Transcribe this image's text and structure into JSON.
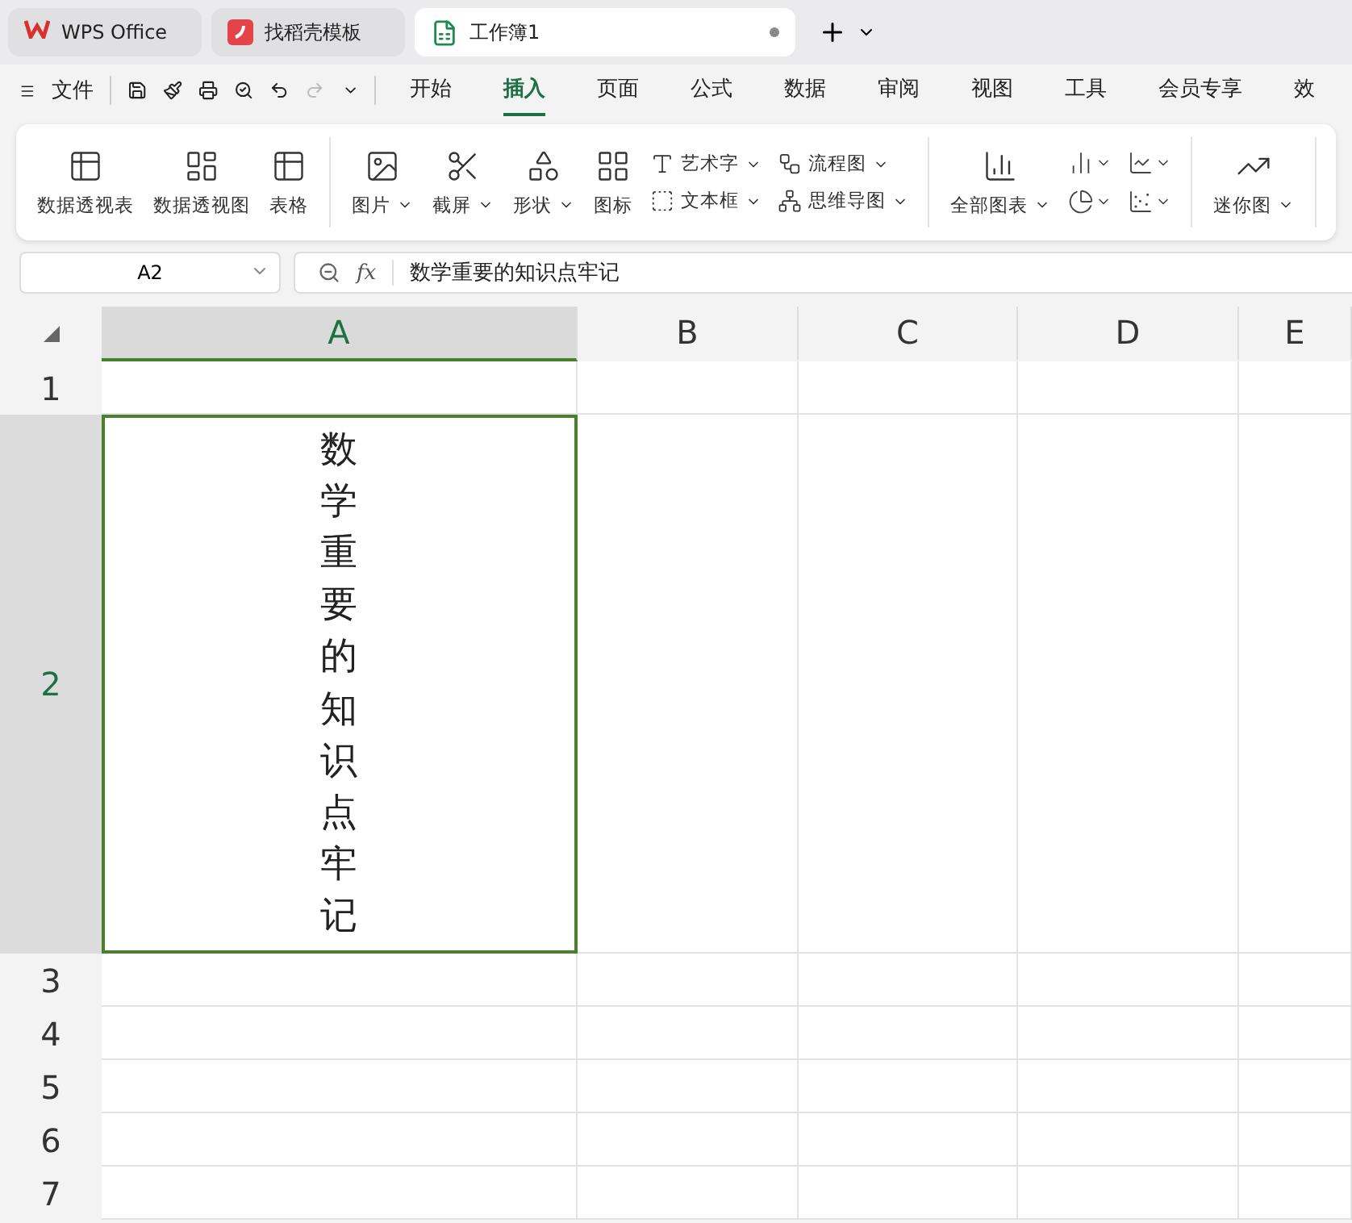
{
  "title_tabs": [
    {
      "label": "WPS Office",
      "kind": "wps",
      "selected": false
    },
    {
      "label": "找稻壳模板",
      "kind": "template",
      "selected": false
    },
    {
      "label": "工作簿1",
      "kind": "sheet",
      "selected": true
    }
  ],
  "menu": {
    "file": "文件",
    "tabs": [
      {
        "label": "开始",
        "selected": false
      },
      {
        "label": "插入",
        "selected": true
      },
      {
        "label": "页面",
        "selected": false
      },
      {
        "label": "公式",
        "selected": false
      },
      {
        "label": "数据",
        "selected": false
      },
      {
        "label": "审阅",
        "selected": false
      },
      {
        "label": "视图",
        "selected": false
      },
      {
        "label": "工具",
        "selected": false
      },
      {
        "label": "会员专享",
        "selected": false
      },
      {
        "label": "效",
        "selected": false
      }
    ]
  },
  "ribbon": [
    {
      "items": [
        {
          "kind": "large",
          "label": "数据透视表",
          "dropdown": false
        },
        {
          "kind": "large",
          "label": "数据透视图",
          "dropdown": false
        },
        {
          "kind": "large",
          "label": "表格",
          "dropdown": false
        }
      ]
    },
    {
      "items": [
        {
          "kind": "large",
          "label": "图片",
          "dropdown": true
        },
        {
          "kind": "large",
          "label": "截屏",
          "dropdown": true
        },
        {
          "kind": "large",
          "label": "形状",
          "dropdown": true
        },
        {
          "kind": "large",
          "label": "图标",
          "dropdown": false
        },
        {
          "kind": "stack",
          "items": [
            {
              "label": "艺术字",
              "dropdown": true
            },
            {
              "label": "文本框",
              "dropdown": true
            }
          ]
        },
        {
          "kind": "stack",
          "items": [
            {
              "label": "流程图",
              "dropdown": true
            },
            {
              "label": "思维导图",
              "dropdown": true
            }
          ]
        }
      ]
    },
    {
      "items": [
        {
          "kind": "large",
          "label": "全部图表",
          "dropdown": true
        },
        {
          "kind": "chart_types"
        }
      ]
    },
    {
      "items": [
        {
          "kind": "large",
          "label": "迷你图",
          "dropdown": true
        }
      ]
    }
  ],
  "formula_bar": {
    "name_box": "A2",
    "fx": "fx",
    "value": "数学重要的知识点牢记"
  },
  "sheet": {
    "columns": [
      {
        "label": "A",
        "selected": true
      },
      {
        "label": "B",
        "selected": false
      },
      {
        "label": "C",
        "selected": false
      },
      {
        "label": "D",
        "selected": false
      },
      {
        "label": "E",
        "selected": false
      }
    ],
    "rows": [
      {
        "label": "1",
        "selected": false,
        "kind": "normal",
        "cells": []
      },
      {
        "label": "2",
        "selected": true,
        "kind": "tall",
        "cells": [
          {
            "value": "数学重要的知识点牢记",
            "vertical": true
          }
        ]
      },
      {
        "label": "3",
        "selected": false,
        "kind": "normal",
        "cells": []
      },
      {
        "label": "4",
        "selected": false,
        "kind": "normal",
        "cells": []
      },
      {
        "label": "5",
        "selected": false,
        "kind": "normal",
        "cells": []
      },
      {
        "label": "6",
        "selected": false,
        "kind": "normal",
        "cells": []
      },
      {
        "label": "7",
        "selected": false,
        "kind": "normal",
        "cells": []
      }
    ]
  }
}
